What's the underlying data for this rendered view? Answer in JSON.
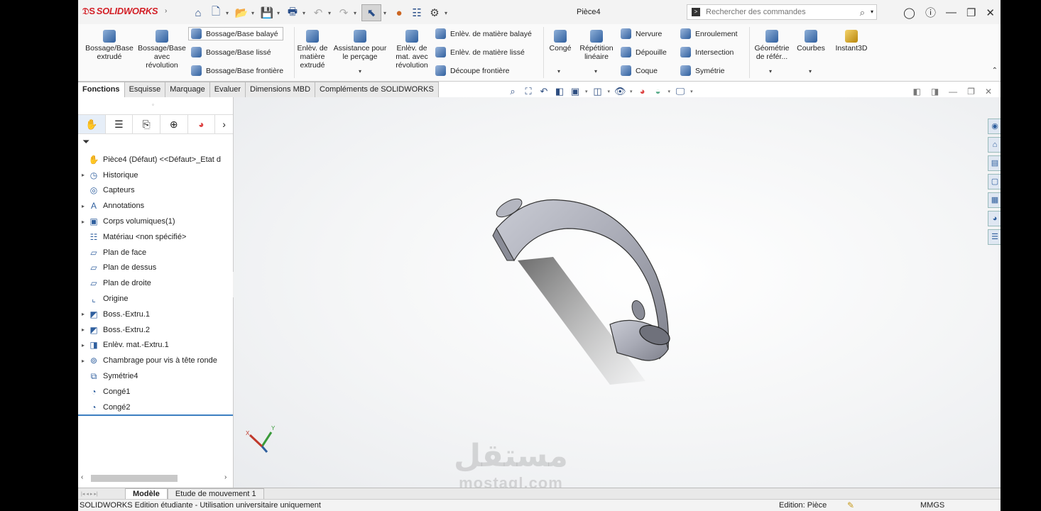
{
  "app": {
    "brand": "SOLIDWORKS",
    "doc_title": "Pièce4",
    "search_placeholder": "Rechercher des commandes"
  },
  "ribbon": {
    "extrude_boss": "Bossage/Base extrudé",
    "revolve_boss": "Bossage/Base avec révolution",
    "swept_boss": "Bossage/Base balayé",
    "lofted_boss": "Bossage/Base lissé",
    "boundary_boss": "Bossage/Base frontière",
    "extruded_cut": "Enlèv. de matière extrudé",
    "hole_wizard": "Assistance pour le perçage",
    "revolved_cut": "Enlèv. de mat. avec révolution",
    "swept_cut": "Enlèv. de matière balayé",
    "lofted_cut": "Enlèv. de matière lissé",
    "boundary_cut": "Découpe frontière",
    "fillet": "Congé",
    "linear_pattern": "Répétition linéaire",
    "rib": "Nervure",
    "draft": "Dépouille",
    "shell": "Coque",
    "wrap": "Enroulement",
    "intersect": "Intersection",
    "mirror": "Symétrie",
    "ref_geometry": "Géométrie de référ...",
    "curves": "Courbes",
    "instant3d": "Instant3D"
  },
  "tabs": [
    "Fonctions",
    "Esquisse",
    "Marquage",
    "Evaluer",
    "Dimensions MBD",
    "Compléments de SOLIDWORKS"
  ],
  "tree": {
    "root": "Pièce4 (Défaut) <<Défaut>_Etat d",
    "items": [
      {
        "label": "Historique",
        "icon": "history-icon",
        "expand": true
      },
      {
        "label": "Capteurs",
        "icon": "sensor-icon",
        "expand": false
      },
      {
        "label": "Annotations",
        "icon": "annotation-icon",
        "expand": true
      },
      {
        "label": "Corps volumiques(1)",
        "icon": "solid-bodies-icon",
        "expand": true
      },
      {
        "label": "Matériau <non spécifié>",
        "icon": "material-icon",
        "expand": false
      },
      {
        "label": "Plan de face",
        "icon": "plane-icon",
        "expand": false
      },
      {
        "label": "Plan de dessus",
        "icon": "plane-icon",
        "expand": false
      },
      {
        "label": "Plan de droite",
        "icon": "plane-icon",
        "expand": false
      },
      {
        "label": "Origine",
        "icon": "origin-icon",
        "expand": false
      },
      {
        "label": "Boss.-Extru.1",
        "icon": "extrude-icon",
        "expand": true
      },
      {
        "label": "Boss.-Extru.2",
        "icon": "extrude-icon",
        "expand": true
      },
      {
        "label": "Enlèv. mat.-Extru.1",
        "icon": "cut-extrude-icon",
        "expand": true
      },
      {
        "label": "Chambrage pour vis à tête ronde",
        "icon": "hole-icon",
        "expand": true
      },
      {
        "label": "Symétrie4",
        "icon": "mirror-icon",
        "expand": false
      },
      {
        "label": "Congé1",
        "icon": "fillet-icon",
        "expand": false
      },
      {
        "label": "Congé2",
        "icon": "fillet-icon",
        "expand": false
      }
    ]
  },
  "watermark": {
    "arabic": "مستقل",
    "latin": "mostaql.com"
  },
  "bottom_tabs": [
    "Modèle",
    "Etude de mouvement 1"
  ],
  "status": {
    "left": "SOLIDWORKS Edition étudiante - Utilisation universitaire uniquement",
    "mode": "Edition: Pièce",
    "units": "MMGS"
  },
  "colors": {
    "brand_red": "#d32027",
    "accent_blue": "#2f5f9e",
    "part_gray": "#a9abb5"
  }
}
